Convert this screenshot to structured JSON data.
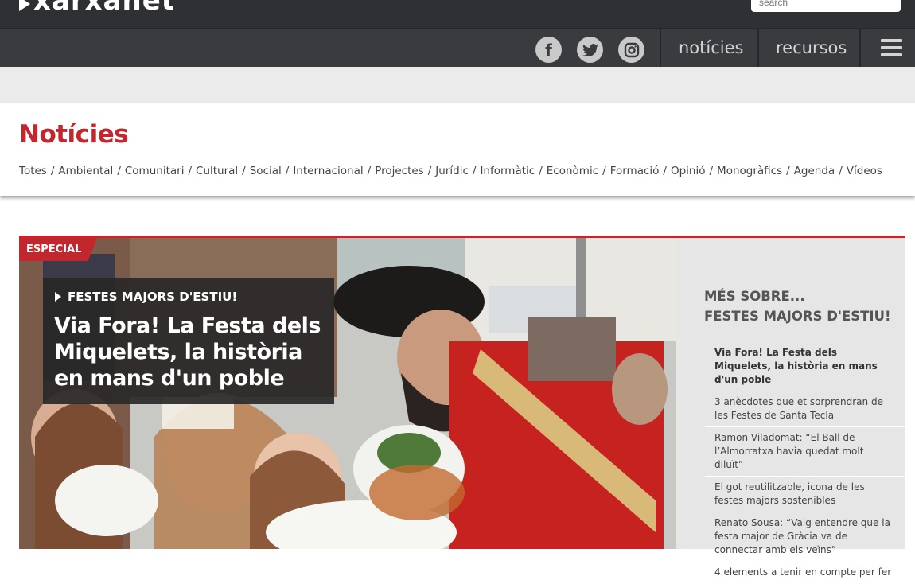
{
  "header": {
    "logo_text": "xarxanet",
    "search_placeholder": "search"
  },
  "nav": {
    "social": [
      {
        "name": "facebook-icon",
        "glyph": "f"
      },
      {
        "name": "twitter-icon",
        "glyph": "t"
      },
      {
        "name": "instagram-icon",
        "glyph": "◎"
      }
    ],
    "links": [
      "notícies",
      "recursos"
    ]
  },
  "section": {
    "title": "Notícies",
    "categories": [
      "Totes",
      "Ambiental",
      "Comunitari",
      "Cultural",
      "Social",
      "Internacional",
      "Projectes",
      "Jurídic",
      "Informàtic",
      "Econòmic",
      "Formació",
      "Opinió",
      "Monogràfics",
      "Agenda",
      "Vídeos"
    ]
  },
  "hero": {
    "badge": "ESPECIAL",
    "kicker": "FESTES MAJORS D'ESTIU!",
    "title": "Via Fora! La Festa dels Miquelets, la història en mans d'un poble"
  },
  "sidebar": {
    "title_line1": "MÉS SOBRE...",
    "title_line2": "FESTES MAJORS D'ESTIU!",
    "items": [
      "Via Fora! La Festa dels Miquelets, la història en mans d'un poble",
      "3 anècdotes que et sorprendran de les Festes de Santa Tecla",
      "Ramon Viladomat: “El Ball de l’Almorratxa havia quedat molt diluït”",
      "El got reutilitzable, icona de les festes majors sostenibles",
      "Renato Sousa: “Vaig entendre que la festa major de Gràcia va de connectar amb els veïns”",
      "4 elements a tenir en compte per fer"
    ]
  },
  "colors": {
    "accent": "#c1272d",
    "header_bg": "#2f3033",
    "nav_bg": "#3a3b3e",
    "sidebar_bg": "#e6e6e6"
  }
}
